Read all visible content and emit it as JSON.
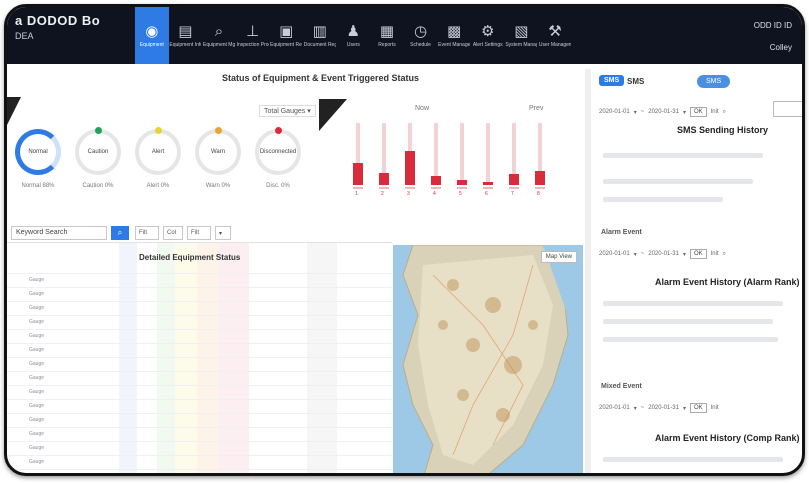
{
  "header": {
    "logo_text": "a DODOD Bo",
    "logo_sub": "DEA",
    "right_line1": "ODD ID ID",
    "right_line2": "Colley"
  },
  "nav": [
    {
      "label": "Equipment",
      "icon": "dashboard-icon",
      "glyph": "◉",
      "active": true
    },
    {
      "label": "Equipment Info",
      "icon": "server-icon",
      "glyph": "▤"
    },
    {
      "label": "Equipment Mgr",
      "icon": "search-icon",
      "glyph": "⌕"
    },
    {
      "label": "Inspection Progress",
      "icon": "tower-icon",
      "glyph": "⊥"
    },
    {
      "label": "Equipment Register",
      "icon": "device-icon",
      "glyph": "▣"
    },
    {
      "label": "Document Registry",
      "icon": "building-icon",
      "glyph": "▥"
    },
    {
      "label": "Users",
      "icon": "user-icon",
      "glyph": "♟"
    },
    {
      "label": "Reports",
      "icon": "document-icon",
      "glyph": "▦"
    },
    {
      "label": "Schedule",
      "icon": "clock-icon",
      "glyph": "◷"
    },
    {
      "label": "Event Management",
      "icon": "calendar-icon",
      "glyph": "▩"
    },
    {
      "label": "Alert Settings",
      "icon": "gear-icon",
      "glyph": "⚙"
    },
    {
      "label": "System Management",
      "icon": "grid-icon",
      "glyph": "▧"
    },
    {
      "label": "User Management",
      "icon": "wrench-icon",
      "glyph": "⚒"
    }
  ],
  "status_panel": {
    "title": "Status of Equipment & Event Triggered Status",
    "select_label": "Total Gauges",
    "donuts": [
      {
        "label": "Normal",
        "caption": "Normal 88%",
        "color": "#2f7be6",
        "value": 0.75
      },
      {
        "label": "Caution",
        "caption": "Caution 0%",
        "color": "#22a35a",
        "value": 0.12
      },
      {
        "label": "Alert",
        "caption": "Alert 0%",
        "color": "#e8d23a",
        "value": 0.06
      },
      {
        "label": "Warn",
        "caption": "Warn 0%",
        "color": "#f0a030",
        "value": 0.04
      },
      {
        "label": "Disconnected",
        "caption": "Disc. 0%",
        "color": "#d92b3a",
        "value": 0.02
      }
    ],
    "bar_headers": [
      "Now",
      "Prev"
    ],
    "bar_values": [
      0.35,
      0.2,
      0.55,
      0.15,
      0.08,
      0.05,
      0.18,
      0.22
    ],
    "bar_labels": [
      "1",
      "2",
      "3",
      "4",
      "5",
      "6",
      "7",
      "8"
    ]
  },
  "sms": {
    "badge": "SMS",
    "pill": "SMS",
    "title": "SMS Sending History",
    "toolbar": [
      "2020-01-01",
      "▾",
      "~",
      "2020-01-31",
      "▾",
      "OK",
      "Init",
      "⌕"
    ]
  },
  "table": {
    "search_placeholder": "Keyword Search",
    "search_btn": "⌕",
    "filters": [
      "Filt",
      "Col",
      "Filt",
      "▾"
    ],
    "title": "Detailed Equipment Status",
    "rows": [
      "Gauge",
      "Gauge",
      "Gauge",
      "Gauge",
      "Gauge",
      "Gauge",
      "Gauge",
      "Gauge",
      "Gauge",
      "Gauge",
      "Gauge",
      "Gauge",
      "Gauge",
      "Gauge",
      "Gauge"
    ]
  },
  "map": {
    "button": "Map View"
  },
  "alarm_event": {
    "label": "Alarm Event",
    "title": "Alarm Event History (Alarm Rank)",
    "toolbar": [
      "2020-01-01",
      "▾",
      "~",
      "2020-01-31",
      "▾",
      "OK",
      "Init",
      "⌕"
    ]
  },
  "mixed_event": {
    "label": "Mixed Event",
    "title": "Alarm Event History (Comp Rank)",
    "toolbar": [
      "2020-01-01",
      "▾",
      "~",
      "2020-01-31",
      "▾",
      "OK",
      "Init"
    ]
  }
}
